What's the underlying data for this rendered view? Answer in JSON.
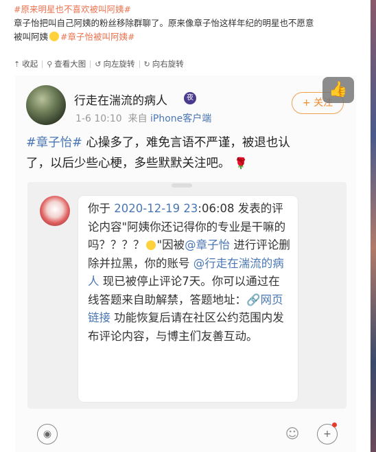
{
  "post": {
    "title_tag": "#原来明星也不喜欢被叫阿姨#",
    "line2": "章子怡把叫自己阿姨的粉丝移除群聊了。原来像章子怡这样年纪的明星也不愿意",
    "line3_prefix": "被叫阿姨",
    "line3_tag": "#章子怡被叫阿姨#"
  },
  "toolbar": {
    "collapse": "收起",
    "view_large": "查看大图",
    "rotate_left": "向左旋转",
    "rotate_right": "向右旋转"
  },
  "screenshot": {
    "username": "行走在湍流的病人",
    "vip_badge": "夜",
    "date": "1-6 10:10",
    "source_prefix": "来自",
    "source": "iPhone客户端",
    "follow_label": "+ 关注",
    "body_tag": "#章子怡#",
    "body_line1": " 心操多了，难免言语不严谨，被退也认",
    "body_line2": "了，以后少些心梗，多些默默关注吧。",
    "notice": {
      "p1": "你于 ",
      "date_link": "2020-12-19 23",
      "p2": ":06:08 发表的评论内容\"阿姨你还记得你的专业是干嘛的吗？？？？",
      "p3": "\"因被",
      "mention1": "@章子怡",
      "p4": " 进行评论删除并拉黑，你的账号 ",
      "mention2": "@行走在湍流的病人",
      "p5": " 现已被停止评论7天。你可以通过在线答题来自助解禁，答题地址：",
      "link_label": "网页链接",
      "p6": " 功能恢复后请在社区公约范围内发布评论内容，与博主们友善互动。"
    }
  },
  "colors": {
    "tag": "#eb7350",
    "link": "#4a77b4",
    "follow": "#f08a2a"
  }
}
